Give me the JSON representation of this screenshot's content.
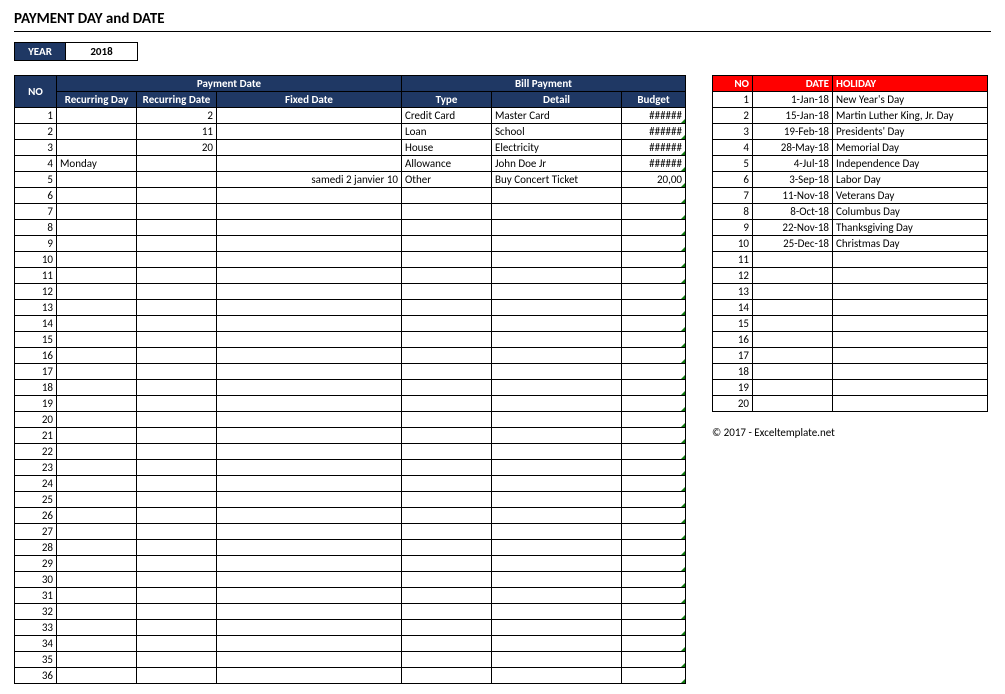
{
  "title": "PAYMENT DAY and DATE",
  "year": {
    "label": "YEAR",
    "value": "2018"
  },
  "main": {
    "header_group_no": "NO",
    "header_group_payment": "Payment Date",
    "header_group_bill": "Bill Payment",
    "header_rday": "Recurring Day",
    "header_rdate": "Recurring Date",
    "header_fdate": "Fixed Date",
    "header_type": "Type",
    "header_detail": "Detail",
    "header_budget": "Budget",
    "total_rows": 36,
    "rows": [
      {
        "no": "1",
        "rday": "",
        "rdate": "2",
        "fdate": "",
        "type": "Credit Card",
        "detail": "Master Card",
        "budget": "######"
      },
      {
        "no": "2",
        "rday": "",
        "rdate": "11",
        "fdate": "",
        "type": "Loan",
        "detail": "School",
        "budget": "######"
      },
      {
        "no": "3",
        "rday": "",
        "rdate": "20",
        "fdate": "",
        "type": "House",
        "detail": "Electricity",
        "budget": "######"
      },
      {
        "no": "4",
        "rday": "Monday",
        "rdate": "",
        "fdate": "",
        "type": "Allowance",
        "detail": "John Doe Jr",
        "budget": "######"
      },
      {
        "no": "5",
        "rday": "",
        "rdate": "",
        "fdate": "samedi 2 janvier 10",
        "type": "Other",
        "detail": "Buy Concert Ticket",
        "budget": "20,00"
      }
    ]
  },
  "holidays": {
    "header_no": "NO",
    "header_date": "DATE",
    "header_holiday": "HOLIDAY",
    "total_rows": 20,
    "rows": [
      {
        "no": "1",
        "date": "1-Jan-18",
        "holiday": "New Year's Day"
      },
      {
        "no": "2",
        "date": "15-Jan-18",
        "holiday": "Martin Luther King, Jr. Day"
      },
      {
        "no": "3",
        "date": "19-Feb-18",
        "holiday": "Presidents' Day"
      },
      {
        "no": "4",
        "date": "28-May-18",
        "holiday": "Memorial Day"
      },
      {
        "no": "5",
        "date": "4-Jul-18",
        "holiday": "Independence Day"
      },
      {
        "no": "6",
        "date": "3-Sep-18",
        "holiday": "Labor Day"
      },
      {
        "no": "7",
        "date": "11-Nov-18",
        "holiday": "Veterans Day"
      },
      {
        "no": "8",
        "date": "8-Oct-18",
        "holiday": "Columbus Day"
      },
      {
        "no": "9",
        "date": "22-Nov-18",
        "holiday": "Thanksgiving Day"
      },
      {
        "no": "10",
        "date": "25-Dec-18",
        "holiday": "Christmas Day"
      }
    ]
  },
  "copyright": "© 2017 - Exceltemplate.net"
}
